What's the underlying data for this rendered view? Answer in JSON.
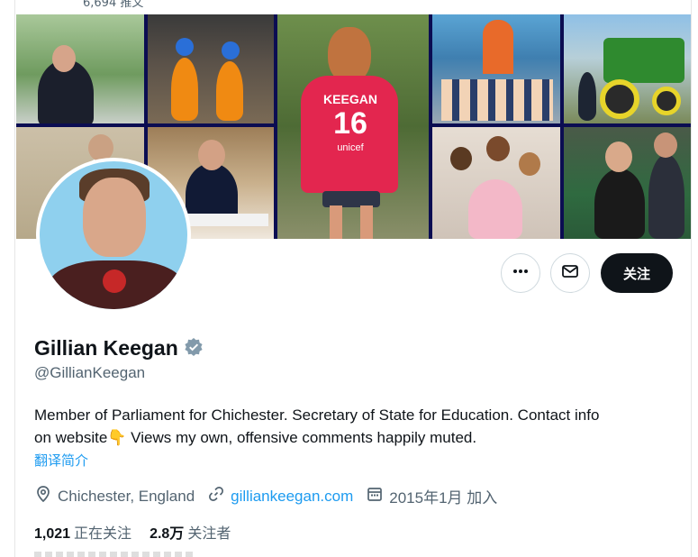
{
  "top_count": "6,694 推文",
  "profile": {
    "name": "Gillian Keegan",
    "handle": "@GillianKeegan",
    "verified": true,
    "bio_line1": "Member of Parliament for Chichester. Secretary of State for Education. Contact info",
    "bio_line2_a": "on website",
    "bio_emoji": "👇",
    "bio_line2_b": " Views my own, offensive comments happily muted.",
    "translate_label": "翻译简介",
    "location": "Chichester, England",
    "website": "gilliankeegan.com",
    "joined": "2015年1月 加入",
    "following_count": "1,021",
    "following_label": "正在关注",
    "followers_count": "2.8万",
    "followers_label": "关注者"
  },
  "banner": {
    "jersey_name": "KEEGAN",
    "jersey_number": "16",
    "jersey_brand": "unicef"
  },
  "actions": {
    "follow_label": "关注",
    "more_icon": "more-icon",
    "message_icon": "envelope-icon"
  },
  "colors": {
    "accent": "#1d9bf0",
    "follow_bg": "#0f1419",
    "verified": "#829aab",
    "banner_border": "#0b0d52"
  }
}
